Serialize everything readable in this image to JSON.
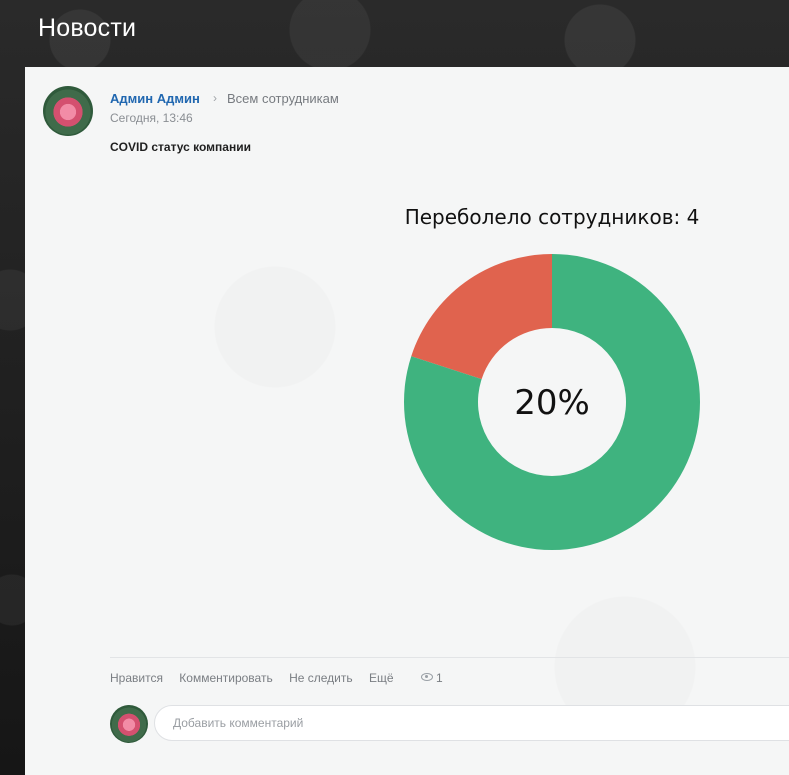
{
  "page": {
    "title": "Новости"
  },
  "post": {
    "author": "Админ Админ",
    "audience": "Всем сотрудникам",
    "time": "Сегодня, 13:46",
    "text": "COVID статус компании"
  },
  "chart_data": {
    "type": "pie",
    "title": "Переболело сотрудников: 4",
    "center_label": "20%",
    "categories": [
      "",
      ""
    ],
    "values": [
      20,
      80
    ],
    "colors": [
      "#e0634e",
      "#3fb37f"
    ]
  },
  "actions": {
    "like": "Нравится",
    "comment": "Комментировать",
    "unfollow": "Не следить",
    "more": "Ещё",
    "views": "1"
  },
  "comment": {
    "placeholder": "Добавить комментарий"
  },
  "icons": {
    "separator": "chevron-right-icon",
    "views": "eye-icon"
  }
}
